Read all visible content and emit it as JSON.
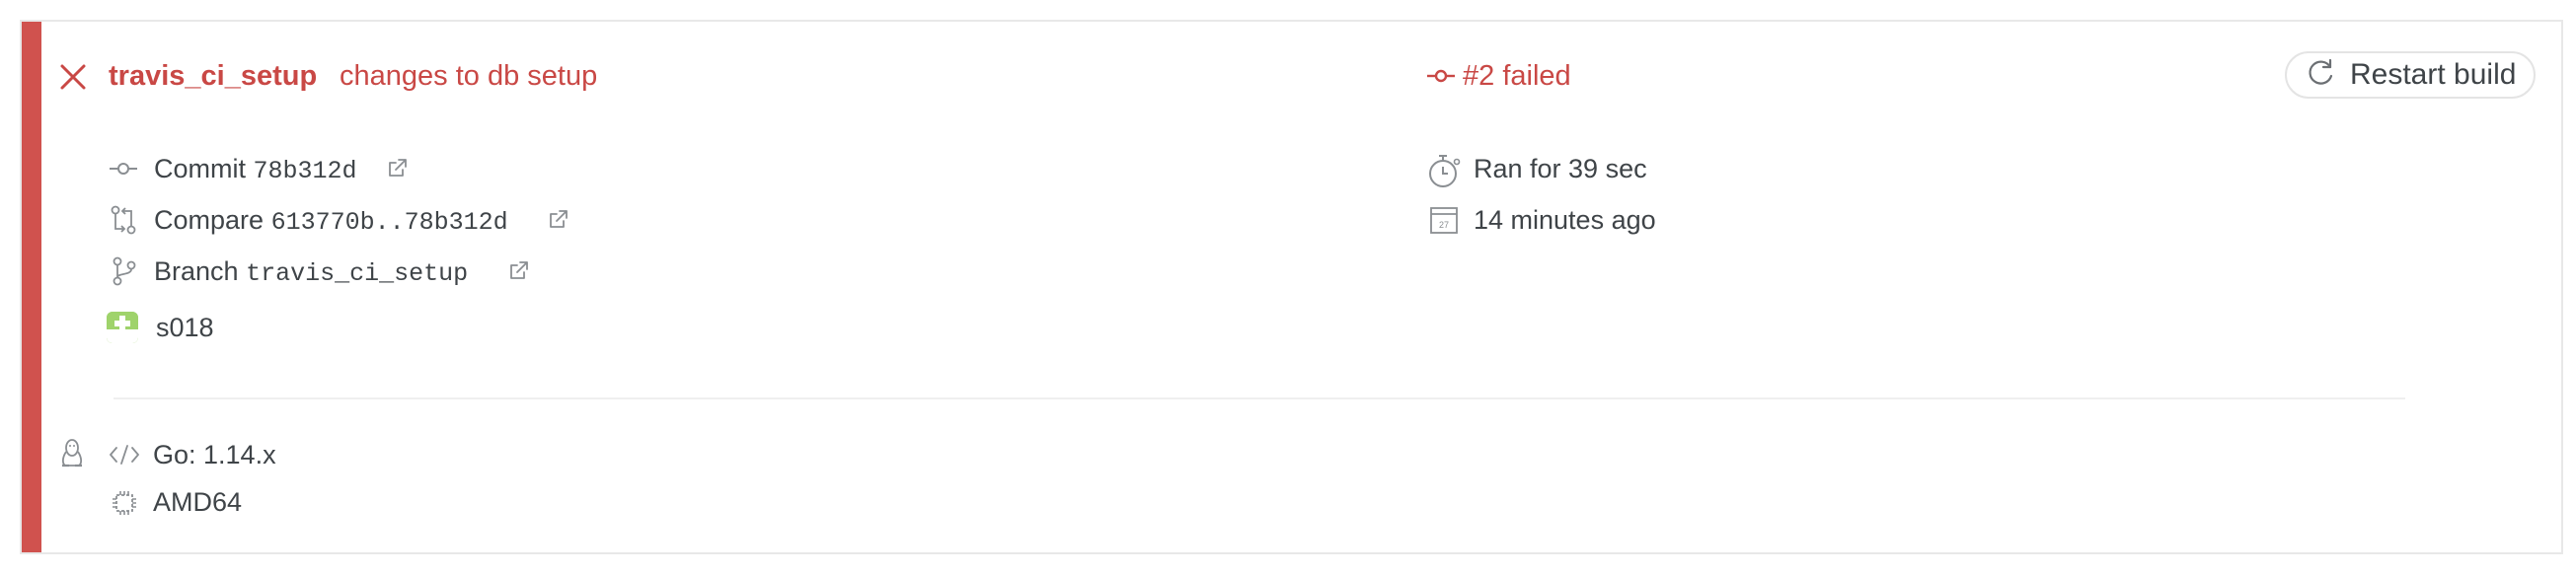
{
  "build": {
    "branch_title": "travis_ci_setup",
    "commit_message": "changes to db setup",
    "status": "#2 failed",
    "accent_color": "#d0524e",
    "status_color": "#c94845"
  },
  "actions": {
    "restart_label": "Restart build"
  },
  "details": {
    "commit_label": "Commit",
    "commit_sha": "78b312d",
    "compare_label": "Compare",
    "compare_range": "613770b..78b312d",
    "branch_label": "Branch",
    "branch_name": "travis_ci_setup",
    "author": "s018"
  },
  "timing": {
    "duration": "Ran for 39 sec",
    "finished": "14 minutes ago",
    "calendar_day": "27"
  },
  "environment": {
    "language": "Go: 1.14.x",
    "arch": "AMD64"
  },
  "icons": {
    "status": "close-icon",
    "commit": "commit-icon",
    "compare": "compare-icon",
    "branch": "branch-icon",
    "external": "external-link-icon",
    "timer": "stopwatch-icon",
    "calendar": "calendar-icon",
    "os": "linux-tux-icon",
    "language": "code-icon",
    "arch": "cpu-icon",
    "restart": "restart-icon"
  }
}
